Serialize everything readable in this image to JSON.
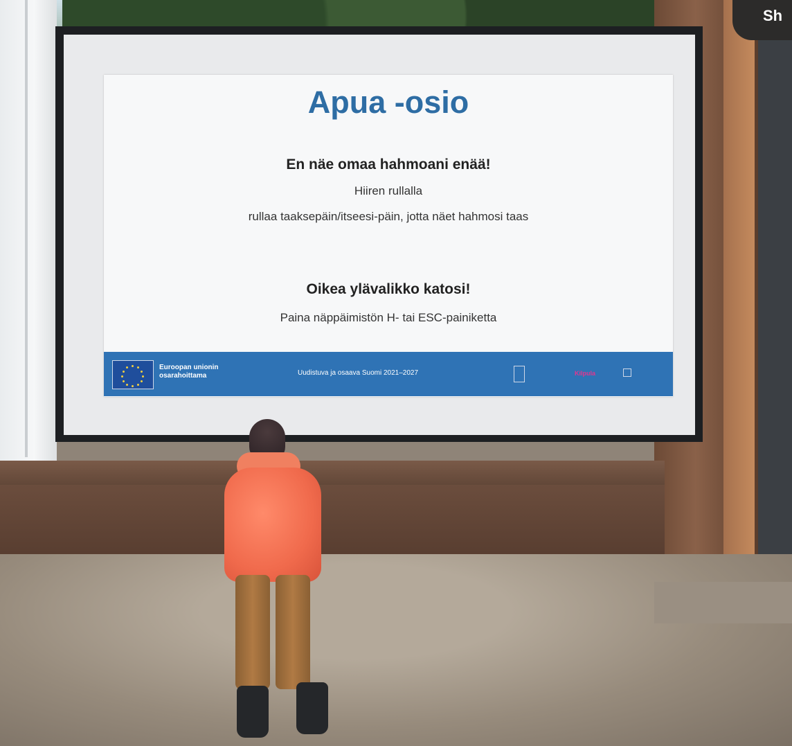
{
  "slide": {
    "title": "Apua -osio",
    "section1_heading": "En näe omaa hahmoani enää!",
    "section1_line1": "Hiiren rullalla",
    "section1_line2": "rullaa taaksepäin/itseesi-päin, jotta näet hahmosi taas",
    "section2_heading": "Oikea ylävalikko katosi!",
    "section2_line1": "Paina näppäimistön H- tai ESC-painiketta"
  },
  "footer": {
    "eu_label_line1": "Euroopan unionin",
    "eu_label_line2": "osarahoittama",
    "program": "Uudistuva ja osaava Suomi 2021–2027",
    "logo2": "Kilpula",
    "colors": {
      "bar": "#2f73b5",
      "title": "#2e6da4",
      "logo2": "#e3358e"
    }
  },
  "top_right": {
    "label": "Sh"
  },
  "icons": [
    "eu-flag-icon",
    "avatar"
  ]
}
